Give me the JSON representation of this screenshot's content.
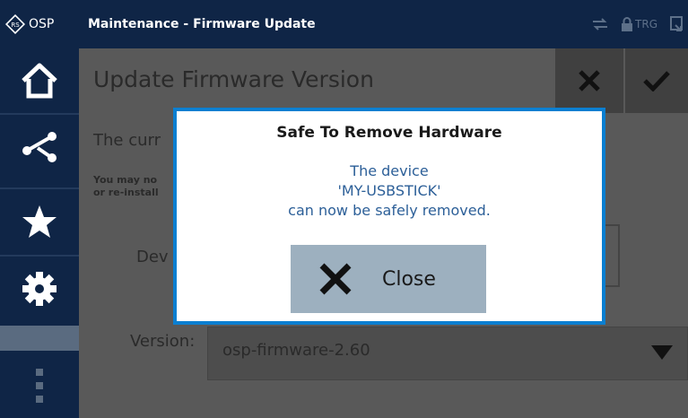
{
  "app": {
    "logo_text": "OSP",
    "title": "Maintenance - Firmware Update",
    "status": {
      "trg_label": "TRG"
    }
  },
  "sidebar": {
    "items": [
      {
        "icon": "home-icon"
      },
      {
        "icon": "network-icon"
      },
      {
        "icon": "star-icon"
      },
      {
        "icon": "gear-icon"
      },
      {
        "icon": "more-icon"
      }
    ]
  },
  "main": {
    "page_title": "Update Firmware Version",
    "current_text": "The curr",
    "info_line1": "You may no",
    "info_line2": "or re-install",
    "device_label": "Dev",
    "version_label": "Version:",
    "version_value": "osp-firmware-2.60"
  },
  "dialog": {
    "title": "Safe To Remove Hardware",
    "line1": "The device",
    "line2": "'MY-USBSTICK'",
    "line3": "can now be safely removed.",
    "close_label": "Close"
  },
  "colors": {
    "nav_bg": "#0f2546",
    "dialog_border": "#0b7fd1",
    "message_text": "#2c5f98",
    "close_button_bg": "#9db0bf"
  }
}
